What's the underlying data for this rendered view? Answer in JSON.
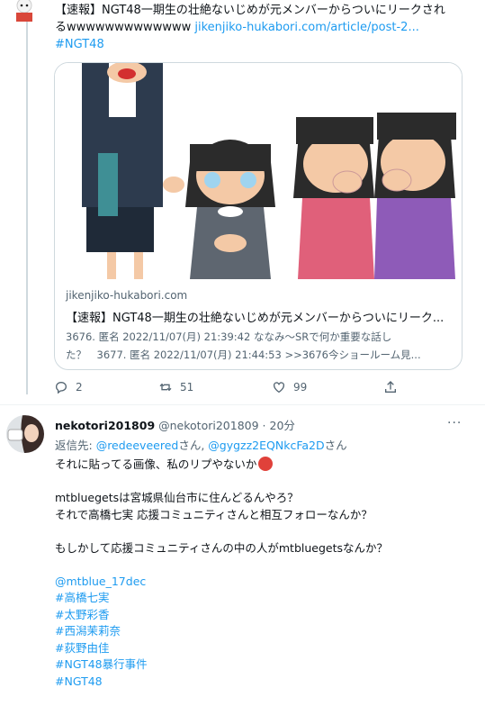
{
  "tweet1": {
    "text_line1": "【速報】NGT48一期生の壮絶ないじめが元メンバーからついにリークされ",
    "text_line2_prefix": "るwwwwwwwwwwwww",
    "link": "jikenjiko-hukabori.com/article/post-2...",
    "hashtag": "#NGT48",
    "card": {
      "domain": "jikenjiko-hukabori.com",
      "title": "【速報】NGT48一期生の壮絶ないじめが元メンバーからついにリーク...",
      "desc_line1": "3676. 匿名 2022/11/07(月) 21:39:42 ななみ～SRで何か重要な話し",
      "desc_line2": "た？　3677. 匿名 2022/11/07(月) 21:44:53 >>3676今ショールーム見..."
    },
    "actions": {
      "replies": "2",
      "retweets": "51",
      "likes": "99"
    }
  },
  "tweet2": {
    "name": "nekotori201809",
    "handle": "@nekotori201809",
    "time": "· 20分",
    "more": "···",
    "reply_prefix": "返信先: ",
    "reply_user1": "@redeeveered",
    "reply_mid": "さん, ",
    "reply_user2": "@gygzz2EQNkcFa2D",
    "reply_suffix": "さん",
    "line1": "それに貼ってる画像、私のリプやないか",
    "line2": "mtbluegetsは宮城県仙台市に住んどるんやろ？",
    "line3": "それで高橋七実 応援コミュニティさんと相互フォローなんか？",
    "line4": "もしかして応援コミュニティさんの中の人がmtbluegetsなんか？",
    "mention": "@mtblue_17dec",
    "hashtags": [
      "#高橋七実",
      "#太野彩香",
      "#西潟茉莉奈",
      "#荻野由佳",
      "#NGT48暴行事件",
      "#NGT48"
    ]
  },
  "colors": {
    "link": "#1d9bf0",
    "muted": "#536471",
    "border": "#cfd9de"
  }
}
